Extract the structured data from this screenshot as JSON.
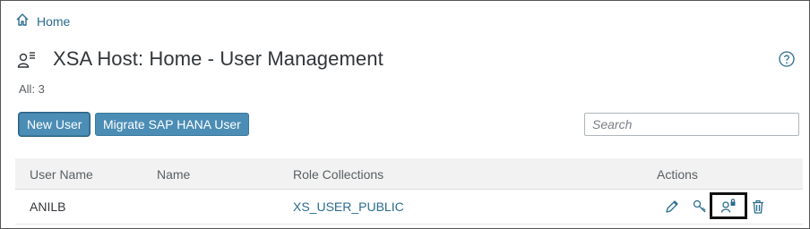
{
  "breadcrumb": {
    "home_label": "Home"
  },
  "header": {
    "title": "XSA Host: Home - User Management"
  },
  "summary": {
    "count_label": "All: 3"
  },
  "toolbar": {
    "new_user_label": "New User",
    "migrate_label": "Migrate SAP HANA User",
    "search_placeholder": "Search"
  },
  "table": {
    "columns": [
      "User Name",
      "Name",
      "Role Collections",
      "Actions"
    ],
    "rows": [
      {
        "user_name": "ANILB",
        "name": "",
        "role_collections": "XS_USER_PUBLIC"
      }
    ]
  },
  "icons": {
    "home": "home-icon",
    "user_list": "user-list-icon",
    "help": "help-icon",
    "edit": "pencil-icon",
    "password": "key-icon",
    "lock": "user-lock-icon",
    "delete": "trash-icon"
  },
  "colors": {
    "accent": "#4b8db5",
    "link": "#2a6c8f"
  }
}
